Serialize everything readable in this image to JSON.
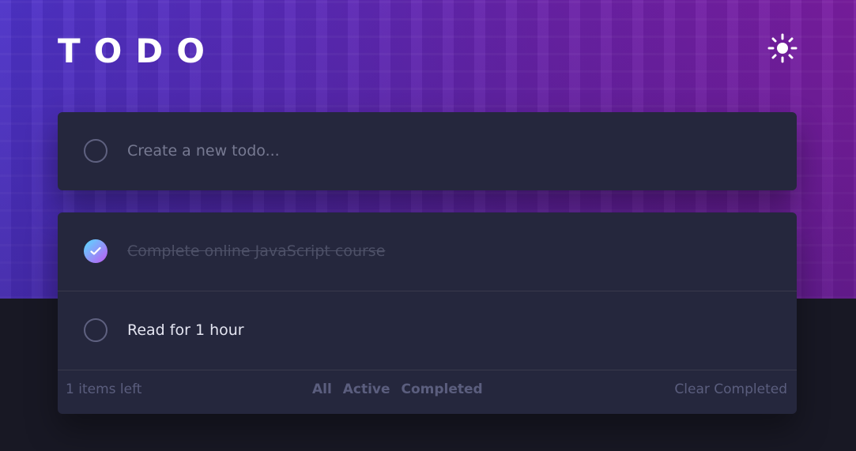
{
  "app": {
    "title": "TODO"
  },
  "theme_toggle": {
    "icon": "sun-icon"
  },
  "create": {
    "placeholder": "Create a new todo..."
  },
  "todos": [
    {
      "text": "Complete online JavaScript course",
      "completed": true
    },
    {
      "text": "Read for 1 hour",
      "completed": false
    }
  ],
  "footer": {
    "items_left": "1 items left",
    "filters": [
      "All",
      "Active",
      "Completed"
    ],
    "clear": "Clear Completed"
  },
  "colors": {
    "background": "#181824",
    "panel": "#25273d",
    "check_gradient_start": "#57ddff",
    "check_gradient_end": "#c058f3"
  }
}
